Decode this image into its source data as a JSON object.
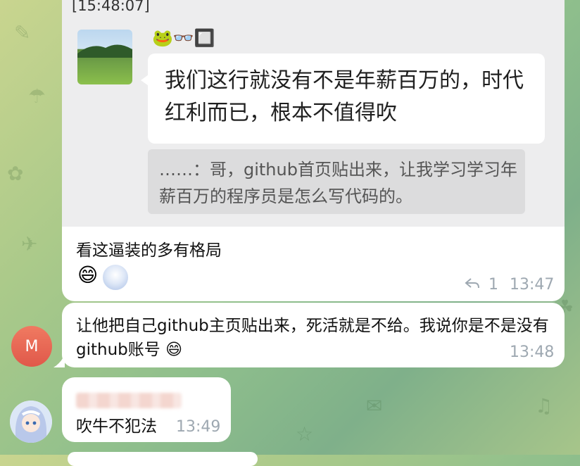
{
  "msg1": {
    "header_time": "[15:48:07]",
    "quoted_sender_emojis": "🐸👓🔲",
    "quoted_text": "我们这行就没有不是年薪百万的，时代红利而已，根本不值得吹",
    "reply_text": "……：哥，github首页贴出来，让我学习学习年薪百万的程序员是怎么写代码的。",
    "caption": "看这逼装的多有格局",
    "reaction_emoji": "😄",
    "reply_count": "1",
    "time": "13:47"
  },
  "msg2": {
    "avatar_letter": "M",
    "text": "让他把自己github主页贴出来，死活就是不给。我说你是不是没有github账号",
    "emoji": "😄",
    "time": "13:48"
  },
  "msg3": {
    "text": "吹牛不犯法",
    "time": "13:49"
  },
  "colors": {
    "avatar_m": "#e0584a",
    "bubble": "#ffffff",
    "time_text": "#9ea8b1"
  },
  "icons": {
    "reply_arrow": "reply-arrow-icon"
  }
}
